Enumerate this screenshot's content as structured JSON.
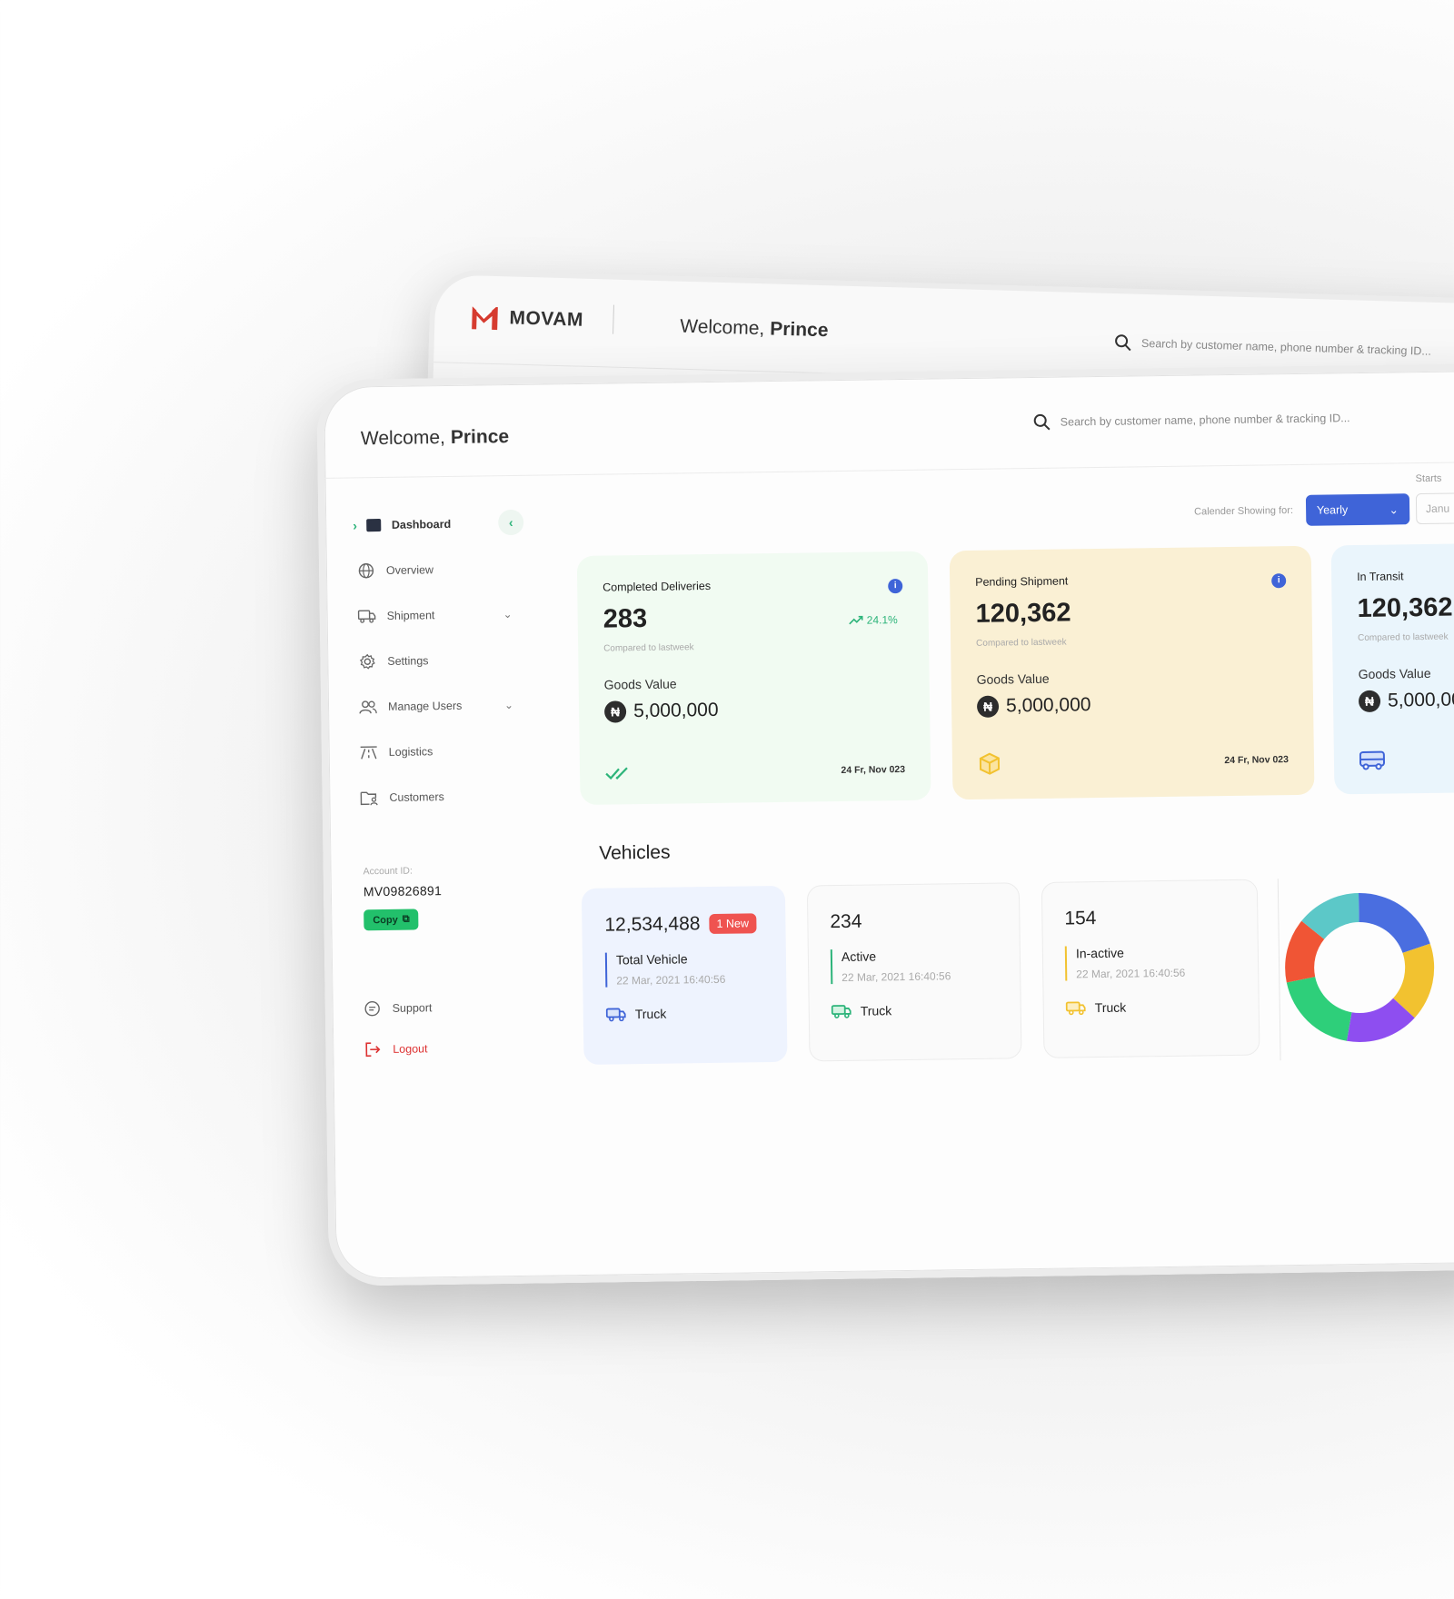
{
  "brand": {
    "name": "MOVAM"
  },
  "welcome": {
    "greeting": "Welcome,",
    "name": "Prince"
  },
  "search": {
    "placeholder": "Search by customer name, phone number & tracking ID..."
  },
  "sidebar": {
    "items": [
      {
        "label": "Dashboard",
        "icon": "dashboard-icon"
      },
      {
        "label": "Overview",
        "icon": "globe-icon"
      },
      {
        "label": "Shipment",
        "icon": "truck-icon"
      },
      {
        "label": "Settings",
        "icon": "gear-icon"
      },
      {
        "label": "Manage Users",
        "icon": "users-icon"
      },
      {
        "label": "Logistics",
        "icon": "road-icon"
      },
      {
        "label": "Customers",
        "icon": "folder-user-icon"
      }
    ],
    "account_label": "Account ID:",
    "account_id": "MV09826891",
    "copy_label": "Copy",
    "support_label": "Support",
    "logout_label": "Logout"
  },
  "calendar": {
    "label": "Calender Showing for:",
    "period": "Yearly",
    "starts_label": "Starts",
    "starts_value": "Janu"
  },
  "cards": [
    {
      "title": "Completed Deliveries",
      "value": "283",
      "trend": "24.1%",
      "compared": "Compared to lastweek",
      "goods_label": "Goods Value",
      "goods_value": "5,000,000",
      "date": "24 Fr, Nov 023",
      "icon": "double-check-icon"
    },
    {
      "title": "Pending Shipment",
      "value": "120,362",
      "compared": "Compared to lastweek",
      "goods_label": "Goods Value",
      "goods_value": "5,000,000",
      "date": "24 Fr, Nov 023",
      "icon": "box-icon"
    },
    {
      "title": "In Transit",
      "value": "120,362",
      "compared": "Compared to lastweek",
      "goods_label": "Goods Value",
      "goods_value": "5,000,00",
      "icon": "bus-icon"
    }
  ],
  "currency_symbol": "₦",
  "vehicles": {
    "title": "Vehicles",
    "items": [
      {
        "count": "12,534,488",
        "badge": "1 New",
        "label": "Total Vehicle",
        "date": "22 Mar, 2021 16:40:56",
        "type": "Truck"
      },
      {
        "count": "234",
        "label": "Active",
        "date": "22 Mar, 2021 16:40:56",
        "type": "Truck"
      },
      {
        "count": "154",
        "label": "In-active",
        "date": "22 Mar, 2021 16:40:56",
        "type": "Truck"
      }
    ]
  },
  "donut": {
    "segments": [
      {
        "color": "#4a6ee0",
        "value": 20
      },
      {
        "color": "#f2c230",
        "value": 17
      },
      {
        "color": "#8e4ef0",
        "value": 16
      },
      {
        "color": "#2ecf7a",
        "value": 19
      },
      {
        "color": "#f05535",
        "value": 14
      },
      {
        "color": "#5cc8c8",
        "value": 14
      }
    ]
  },
  "colors": {
    "accent": "#3f64d8",
    "green": "#2db47a",
    "yellow": "#f2c230",
    "red": "#ef5350"
  }
}
